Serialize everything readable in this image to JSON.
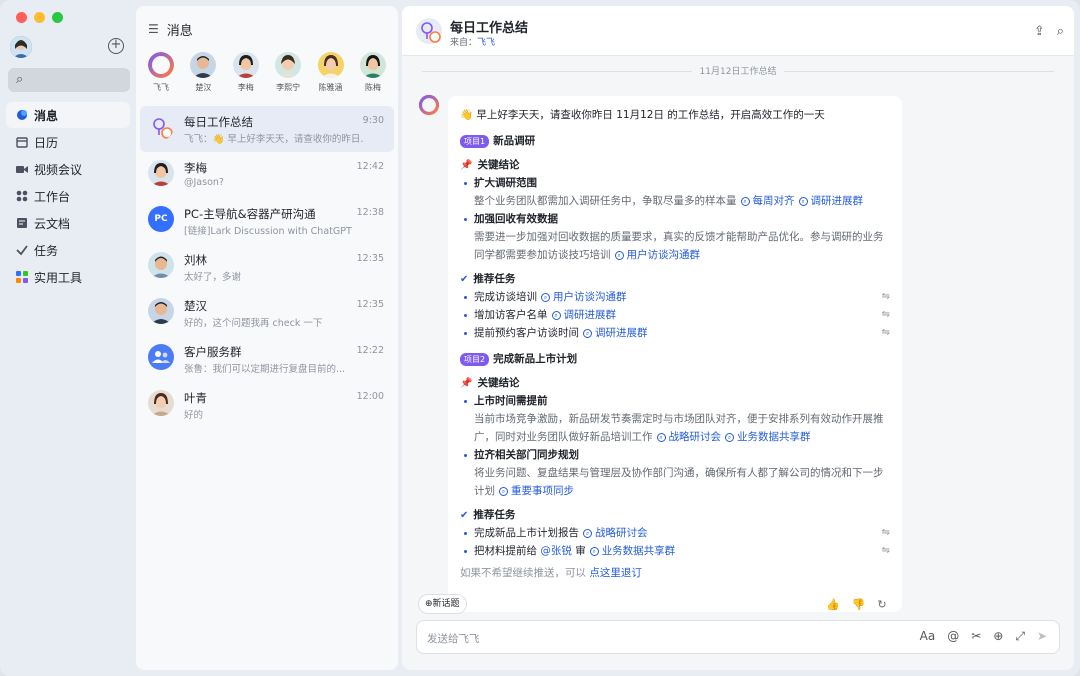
{
  "window": {
    "lights": [
      "#ff5f57",
      "#febc2e",
      "#28c840"
    ]
  },
  "sidebar": {
    "search_icon": "search-icon",
    "items": [
      {
        "label": "消息",
        "icon": "message-icon",
        "active": true
      },
      {
        "label": "日历",
        "icon": "calendar-icon"
      },
      {
        "label": "视频会议",
        "icon": "video-icon"
      },
      {
        "label": "工作台",
        "icon": "workspace-icon"
      },
      {
        "label": "云文档",
        "icon": "docs-icon"
      },
      {
        "label": "任务",
        "icon": "task-icon"
      },
      {
        "label": "实用工具",
        "icon": "tools-icon"
      }
    ]
  },
  "chatlist": {
    "title": "消息",
    "pinned": [
      {
        "name": "飞飞"
      },
      {
        "name": "楚汉"
      },
      {
        "name": "李梅"
      },
      {
        "name": "李熙宁"
      },
      {
        "name": "陈雅涵"
      },
      {
        "name": "陈梅"
      }
    ],
    "chats": [
      {
        "name": "每日工作总结",
        "preview": "飞飞：👋 早上好李天天，请查收你的昨日...",
        "time": "9:30"
      },
      {
        "name": "李梅",
        "preview": "@Jason?",
        "time": "12:42"
      },
      {
        "name": "PC-主导航&容器产研沟通",
        "preview": "[链接]Lark Discussion with ChatGPT",
        "time": "12:38",
        "avatar_text": "PC"
      },
      {
        "name": "刘林",
        "preview": "太好了，多谢",
        "time": "12:35"
      },
      {
        "name": "楚汉",
        "preview": "好的，这个问题我再 check 一下",
        "time": "12:35"
      },
      {
        "name": "客户服务群",
        "preview": "张鲁：我们可以定期进行复盘目前的...",
        "time": "12:22"
      },
      {
        "name": "叶青",
        "preview": "好的",
        "time": "12:00"
      }
    ]
  },
  "main": {
    "title": "每日工作总结",
    "from_label": "来自：",
    "from_name": "飞飞",
    "date_divider": "11月12日工作总结",
    "greeting": "👋 早上好李天天，请查收你昨日 11月12日 的工作总结，开启高效工作的一天",
    "projects": [
      {
        "tag": "项目1",
        "name": "新品调研",
        "conclusion_label": "关键结论",
        "points": [
          {
            "title": "扩大调研范围",
            "lines": [
              "整个业务团队都需加入调研任务中，争取尽量多的样本量"
            ],
            "links": [
              "每周对齐",
              "调研进展群"
            ]
          },
          {
            "title": "加强回收有效数据",
            "lines": [
              "需要进一步加强对回收数据的质量要求，真实的反馈才能帮助产品优化。参与调研的业务",
              "同学都需要参加访谈技巧培训"
            ],
            "links": [
              "用户访谈沟通群"
            ]
          }
        ],
        "task_label": "推荐任务",
        "tasks": [
          {
            "text": "完成访谈培训",
            "links": [
              "用户访谈沟通群"
            ]
          },
          {
            "text": "增加访客户名单",
            "links": [
              "调研进展群"
            ]
          },
          {
            "text": "提前预约客户访谈时间",
            "links": [
              "调研进展群"
            ]
          }
        ]
      },
      {
        "tag": "项目2",
        "name": "完成新品上市计划",
        "conclusion_label": "关键结论",
        "points": [
          {
            "title": "上市时间需提前",
            "lines": [
              "当前市场竞争激励，新品研发节奏需定时与市场团队对齐，便于安排系列有效动作开展推",
              "广，同时对业务团队做好新品培训工作"
            ],
            "links": [
              "战略研讨会",
              "业务数据共享群"
            ]
          },
          {
            "title": "拉齐相关部门同步规划",
            "lines": [
              "将业务问题、复盘结果与管理层及协作部门沟通，确保所有人都了解公司的情况和下一步",
              "计划"
            ],
            "links": [
              "重要事项同步"
            ]
          }
        ],
        "task_label": "推荐任务",
        "tasks": [
          {
            "text": "完成新品上市计划报告",
            "links": [
              "战略研讨会"
            ]
          },
          {
            "text": "把材料提前给",
            "mention": "@张锐",
            "tail": "审",
            "links": [
              "业务数据共享群"
            ]
          }
        ]
      }
    ],
    "footer_text": "如果不希望继续推送，可以",
    "footer_link": "点这里退订",
    "new_topic": "新话题",
    "input_placeholder": "发送给飞飞"
  }
}
